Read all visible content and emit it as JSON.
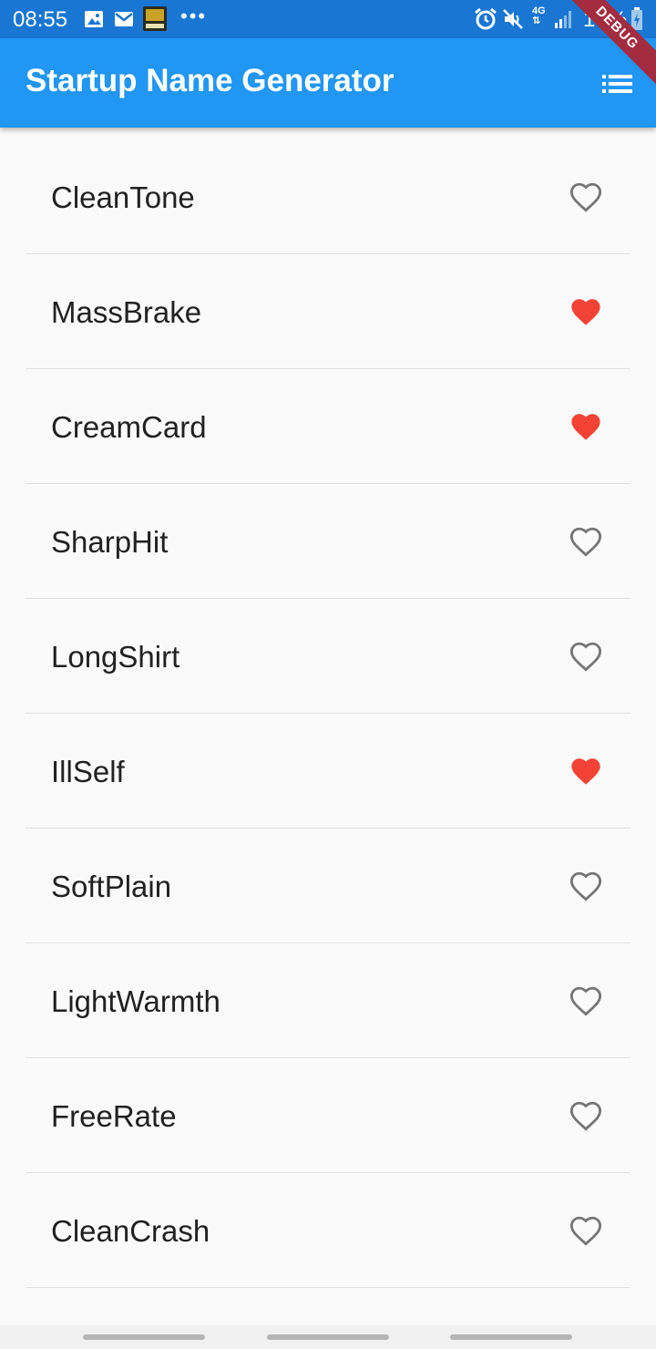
{
  "status_bar": {
    "time": "08:55",
    "battery_text": "14%",
    "network": "4G",
    "icons": [
      "gallery-icon",
      "mail-icon",
      "game-app-icon",
      "more-icon",
      "alarm-icon",
      "mute-icon",
      "network-4g-icon",
      "signal-icon",
      "battery-charging-icon"
    ],
    "debug_label": "DEBUG"
  },
  "app_bar": {
    "title": "Startup Name Generator",
    "action_icon": "list-icon"
  },
  "colors": {
    "status_bar": "#1976d2",
    "app_bar": "#2196f3",
    "favorite": "#f44336",
    "not_favorite": "#757575",
    "debug_banner": "#a32d3f"
  },
  "names": [
    {
      "label": "CleanTone",
      "favorite": false
    },
    {
      "label": "MassBrake",
      "favorite": true
    },
    {
      "label": "CreamCard",
      "favorite": true
    },
    {
      "label": "SharpHit",
      "favorite": false
    },
    {
      "label": "LongShirt",
      "favorite": false
    },
    {
      "label": "IllSelf",
      "favorite": true
    },
    {
      "label": "SoftPlain",
      "favorite": false
    },
    {
      "label": "LightWarmth",
      "favorite": false
    },
    {
      "label": "FreeRate",
      "favorite": false
    },
    {
      "label": "CleanCrash",
      "favorite": false
    }
  ]
}
